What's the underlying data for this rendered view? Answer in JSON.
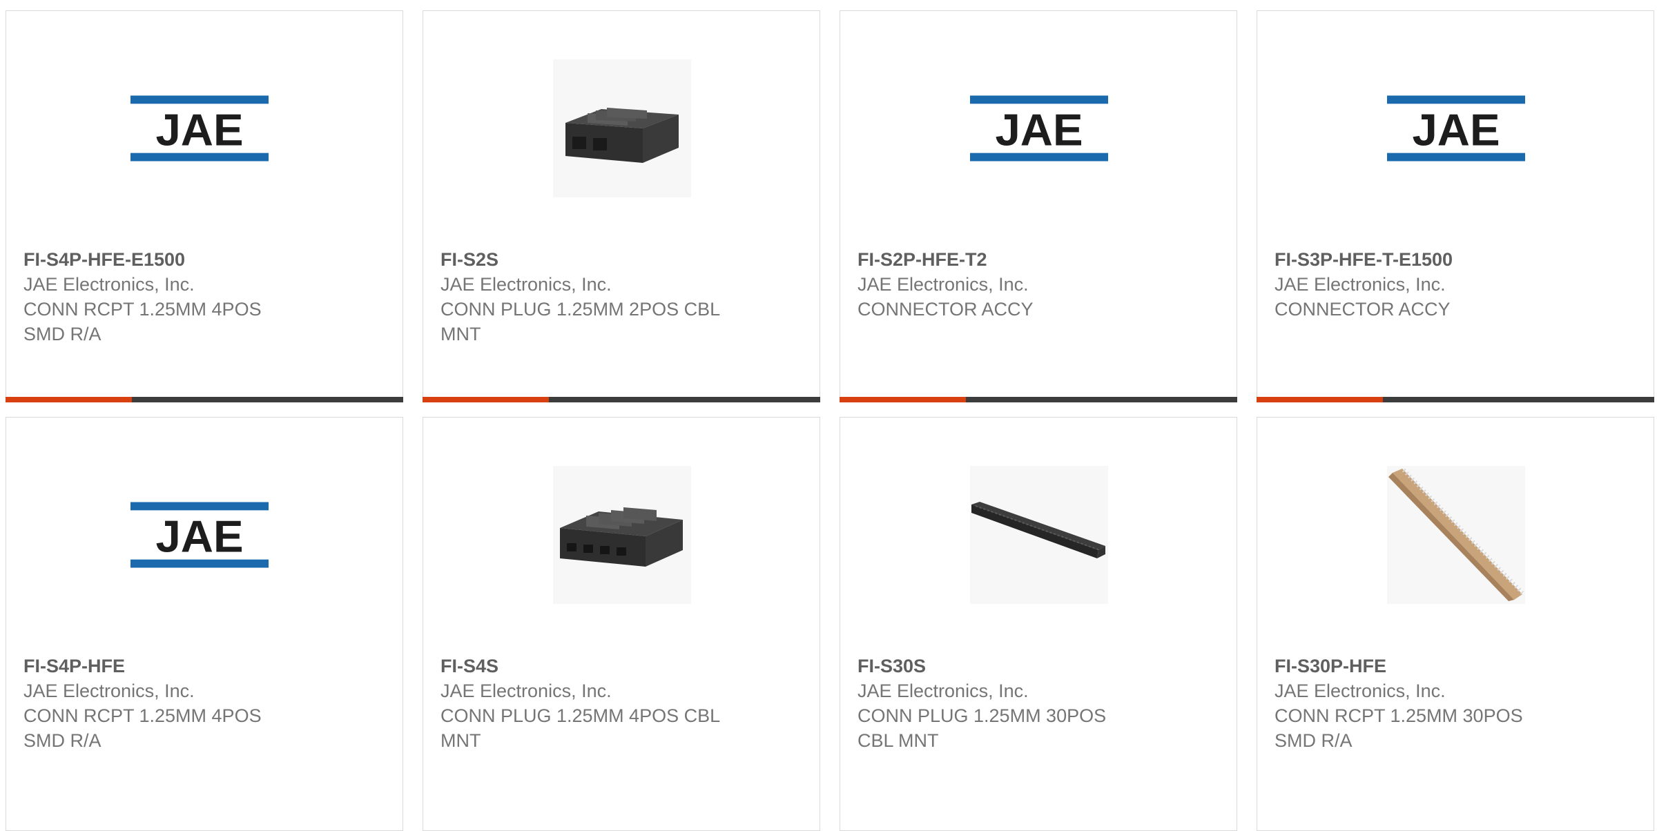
{
  "colors": {
    "jae_blue": "#1a6aad",
    "accent_orange": "#d9400f",
    "bar_dark": "#3c3c3c",
    "text_gray": "#757575"
  },
  "products": [
    {
      "part": "FI-S4P-HFE-E1500",
      "manufacturer": "JAE Electronics, Inc.",
      "desc1": "CONN RCPT 1.25MM 4POS",
      "desc2": "SMD R/A",
      "image": "jae-logo",
      "logo_text": "JAE"
    },
    {
      "part": "FI-S2S",
      "manufacturer": "JAE Electronics, Inc.",
      "desc1": "CONN PLUG 1.25MM 2POS CBL",
      "desc2": "MNT",
      "image": "connector-plug-2pos"
    },
    {
      "part": "FI-S2P-HFE-T2",
      "manufacturer": "JAE Electronics, Inc.",
      "desc1": "CONNECTOR ACCY",
      "desc2": "",
      "image": "jae-logo",
      "logo_text": "JAE"
    },
    {
      "part": "FI-S3P-HFE-T-E1500",
      "manufacturer": "JAE Electronics, Inc.",
      "desc1": "CONNECTOR ACCY",
      "desc2": "",
      "image": "jae-logo",
      "logo_text": "JAE"
    },
    {
      "part": "FI-S4P-HFE",
      "manufacturer": "JAE Electronics, Inc.",
      "desc1": "CONN RCPT 1.25MM 4POS",
      "desc2": "SMD R/A",
      "image": "jae-logo",
      "logo_text": "JAE"
    },
    {
      "part": "FI-S4S",
      "manufacturer": "JAE Electronics, Inc.",
      "desc1": "CONN PLUG 1.25MM 4POS CBL",
      "desc2": "MNT",
      "image": "connector-plug-4pos"
    },
    {
      "part": "FI-S30S",
      "manufacturer": "JAE Electronics, Inc.",
      "desc1": "CONN PLUG 1.25MM 30POS",
      "desc2": "CBL MNT",
      "image": "connector-plug-30pos"
    },
    {
      "part": "FI-S30P-HFE",
      "manufacturer": "JAE Electronics, Inc.",
      "desc1": "CONN RCPT 1.25MM 30POS",
      "desc2": "SMD R/A",
      "image": "connector-rcpt-30pos"
    }
  ]
}
